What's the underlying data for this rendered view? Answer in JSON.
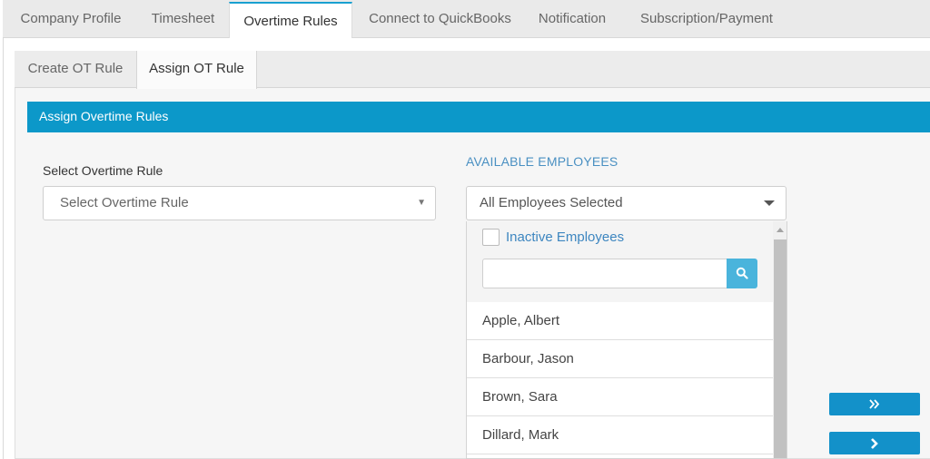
{
  "top_tabs": [
    {
      "label": "Company Profile"
    },
    {
      "label": "Timesheet"
    },
    {
      "label": "Overtime Rules",
      "active": true
    },
    {
      "label": "Connect to QuickBooks"
    },
    {
      "label": "Notification"
    },
    {
      "label": "Subscription/Payment"
    }
  ],
  "sub_tabs": [
    {
      "label": "Create OT Rule"
    },
    {
      "label": "Assign OT Rule",
      "active": true
    }
  ],
  "section_title": "Assign Overtime Rules",
  "overtime_rule": {
    "label": "Select Overtime Rule",
    "placeholder": "Select Overtime Rule"
  },
  "available": {
    "label": "AVAILABLE EMPLOYEES",
    "selected_text": "All Employees Selected",
    "inactive_label": "Inactive Employees",
    "inactive_checked": false,
    "search_value": "",
    "employees": [
      "Apple, Albert",
      "Barbour, Jason",
      "Brown, Sara",
      "Dillard, Mark"
    ]
  },
  "actions": {
    "move_all_icon": "double-chevron-right-icon",
    "move_one_icon": "chevron-right-icon"
  },
  "colors": {
    "accent": "#0c98c9",
    "tab_highlight": "#18a0d0",
    "link": "#3d86c0",
    "button": "#1391c9"
  }
}
